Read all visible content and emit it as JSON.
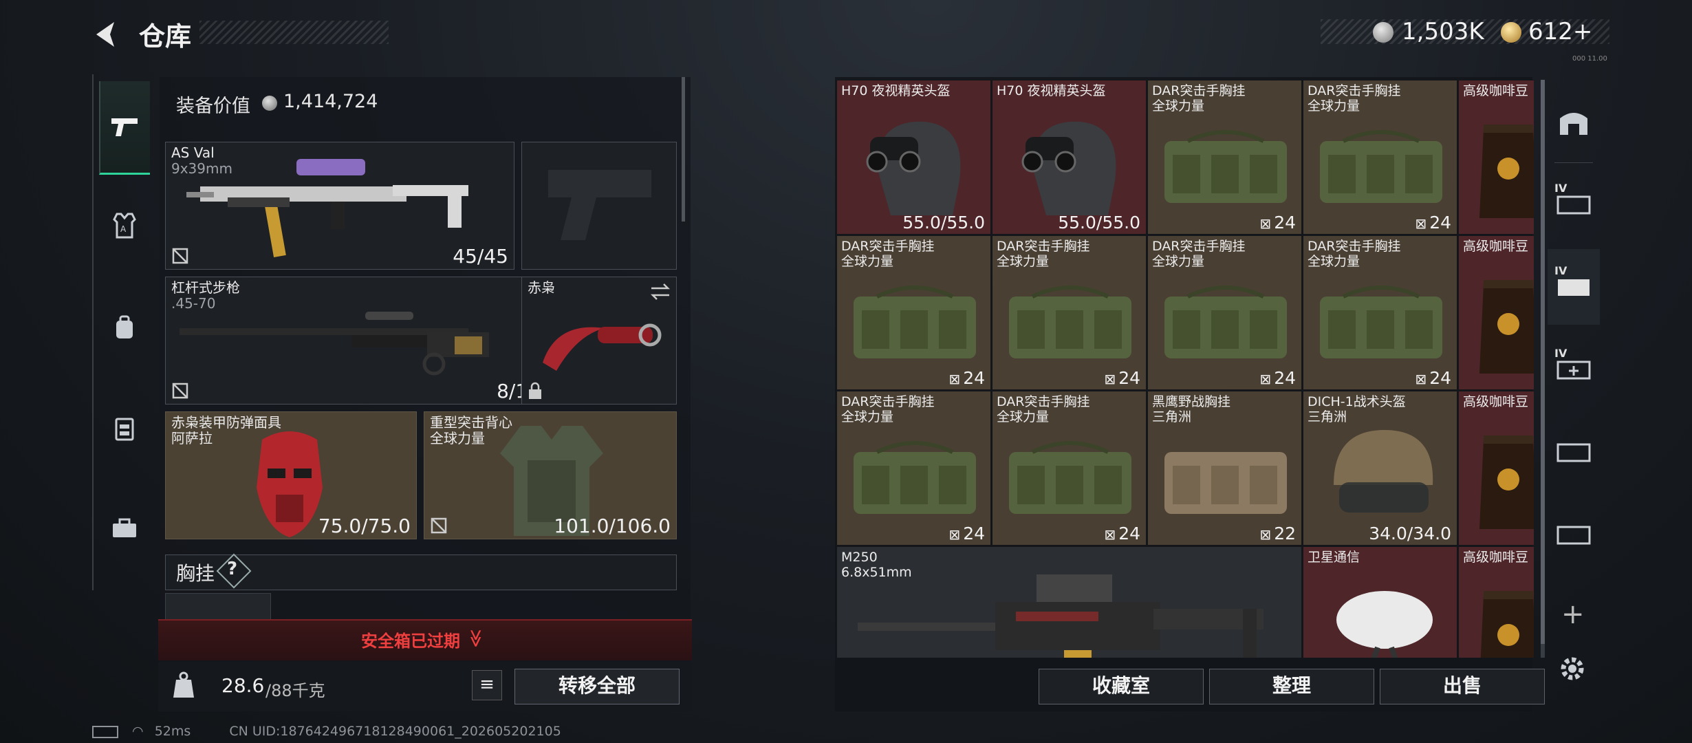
{
  "header": {
    "title": "仓库",
    "currency1": "1,503K",
    "currency2": "612+",
    "version": "000 11.00"
  },
  "left_tabs": [
    "pistol-icon",
    "armor-icon",
    "backpack-icon",
    "rig-icon",
    "case-icon"
  ],
  "loadout": {
    "equip_label": "装备价值",
    "equip_value": "1,414,724",
    "primary": {
      "name": "AS Val",
      "ammo": "9x39mm",
      "value": "45/45"
    },
    "secondary": {
      "name": "杠杆式步枪",
      "ammo": ".45-70",
      "value": "8/10"
    },
    "melee": {
      "name": "赤枭"
    },
    "helmet": {
      "name": "赤枭装甲防弹面具",
      "sub": "阿萨拉",
      "value": "75.0/75.0"
    },
    "armor": {
      "name": "重型突击背心",
      "sub": "全球力量",
      "value": "101.0/106.0"
    },
    "rig_label": "胸挂",
    "rig_q": "?",
    "expired": "安全箱已过期",
    "expired_chevron": "≫",
    "weight": "28.6",
    "weight_max": "/88千克",
    "transfer": "转移全部"
  },
  "stash": {
    "items": [
      {
        "name": "H70 夜视精英头盔",
        "sub": "",
        "value": "55.0/55.0"
      },
      {
        "name": "H70 夜视精英头盔",
        "sub": "",
        "value": "55.0/55.0"
      },
      {
        "name": "DAR突击手胸挂",
        "sub": "全球力量",
        "value": "24"
      },
      {
        "name": "DAR突击手胸挂",
        "sub": "全球力量",
        "value": "24"
      },
      {
        "name": "高级咖啡豆",
        "sub": "",
        "value": ""
      },
      {
        "name": "DAR突击手胸挂",
        "sub": "全球力量",
        "value": "24"
      },
      {
        "name": "DAR突击手胸挂",
        "sub": "全球力量",
        "value": "24"
      },
      {
        "name": "DAR突击手胸挂",
        "sub": "全球力量",
        "value": "24"
      },
      {
        "name": "DAR突击手胸挂",
        "sub": "全球力量",
        "value": "24"
      },
      {
        "name": "高级咖啡豆",
        "sub": "",
        "value": ""
      },
      {
        "name": "DAR突击手胸挂",
        "sub": "全球力量",
        "value": "24"
      },
      {
        "name": "DAR突击手胸挂",
        "sub": "全球力量",
        "value": "24"
      },
      {
        "name": "黑鹰野战胸挂",
        "sub": "三角洲",
        "value": "22"
      },
      {
        "name": "DICH-1战术头盔",
        "sub": "三角洲",
        "value": "34.0/34.0"
      },
      {
        "name": "高级咖啡豆",
        "sub": "",
        "value": ""
      },
      {
        "name": "M250",
        "sub": "6.8x51mm",
        "value": ""
      },
      {
        "name": "卫星通信",
        "sub": "",
        "value": ""
      },
      {
        "name": "高级咖啡豆",
        "sub": "",
        "value": ""
      }
    ],
    "buttons": {
      "collection": "收藏室",
      "sort": "整理",
      "sell": "出售"
    }
  },
  "right_tabs": {
    "tag1": "IV",
    "tag2": "IV",
    "tag3": "IV",
    "plus": "+"
  },
  "status": {
    "ping": "52ms",
    "uid": "CN UID:187642496718128490061_202605202105"
  }
}
